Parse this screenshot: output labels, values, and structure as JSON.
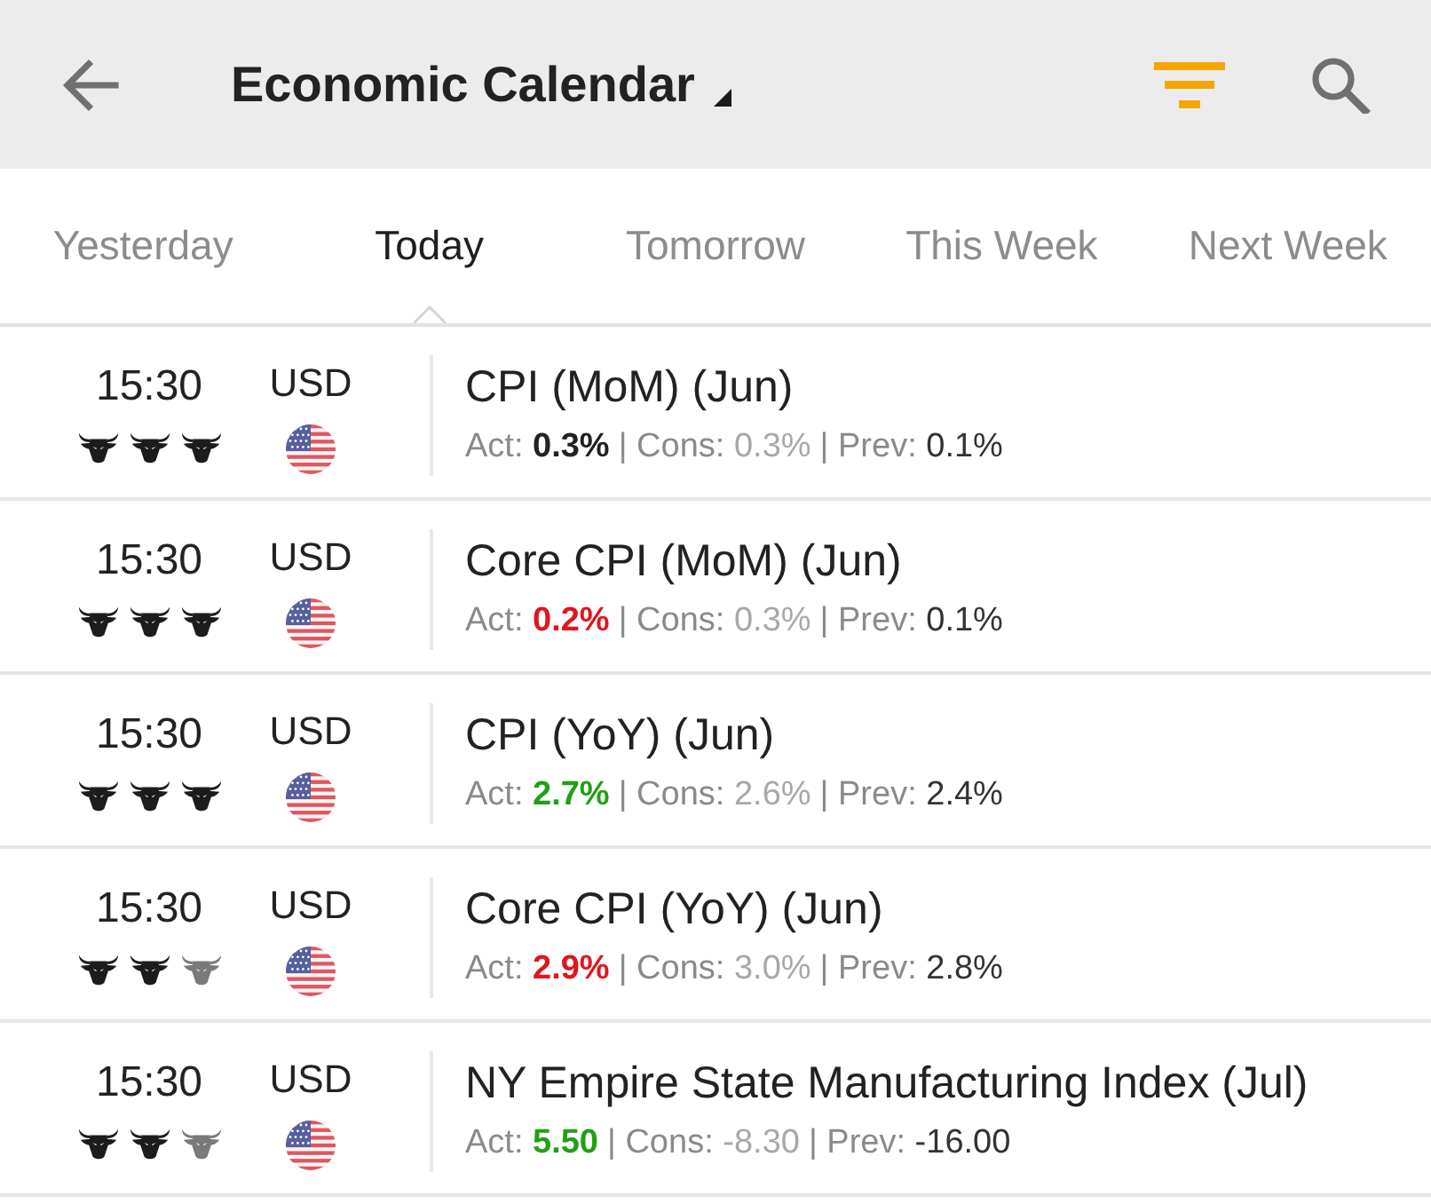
{
  "header": {
    "title": "Economic Calendar"
  },
  "tabs": [
    {
      "label": "Yesterday",
      "selected": false
    },
    {
      "label": "Today",
      "selected": true
    },
    {
      "label": "Tomorrow",
      "selected": false
    },
    {
      "label": "This Week",
      "selected": false
    },
    {
      "label": "Next Week",
      "selected": false
    }
  ],
  "events": [
    {
      "time": "15:30",
      "stars": 3,
      "currency": "USD",
      "name": "CPI (MoM) (Jun)",
      "figures": [
        {
          "kind": "actual",
          "label": "Act:",
          "value": "0.3%",
          "color": "#222222"
        },
        {
          "kind": "consensus",
          "label": "| Cons:",
          "value": "0.3%"
        },
        {
          "kind": "previous",
          "label": "| Prev:",
          "value": "0.1%"
        }
      ]
    },
    {
      "time": "15:30",
      "stars": 3,
      "currency": "USD",
      "name": "Core CPI (MoM) (Jun)",
      "figures": [
        {
          "kind": "actual",
          "label": "Act:",
          "value": "0.2%",
          "color": "#e0161e"
        },
        {
          "kind": "consensus",
          "label": "| Cons:",
          "value": "0.3%"
        },
        {
          "kind": "previous",
          "label": "| Prev:",
          "value": "0.1%"
        }
      ]
    },
    {
      "time": "15:30",
      "stars": 3,
      "currency": "USD",
      "name": "CPI (YoY) (Jun)",
      "figures": [
        {
          "kind": "actual",
          "label": "Act:",
          "value": "2.7%",
          "color": "#22a015"
        },
        {
          "kind": "consensus",
          "label": "| Cons:",
          "value": "2.6%"
        },
        {
          "kind": "previous",
          "label": "| Prev:",
          "value": "2.4%"
        }
      ]
    },
    {
      "time": "15:30",
      "stars": 2,
      "currency": "USD",
      "name": "Core CPI (YoY) (Jun)",
      "figures": [
        {
          "kind": "actual",
          "label": "Act:",
          "value": "2.9%",
          "color": "#e0161e"
        },
        {
          "kind": "consensus",
          "label": "| Cons:",
          "value": "3.0%"
        },
        {
          "kind": "previous",
          "label": "| Prev:",
          "value": "2.8%"
        }
      ]
    },
    {
      "time": "15:30",
      "stars": 2,
      "currency": "USD",
      "name": "NY Empire State Manufacturing Index (Jul)",
      "figures": [
        {
          "kind": "actual",
          "label": "Act:",
          "value": "5.50",
          "color": "#22a015"
        },
        {
          "kind": "consensus",
          "label": "| Cons:",
          "value": "-8.30"
        },
        {
          "kind": "previous",
          "label": "| Prev:",
          "value": "-16.00"
        }
      ]
    }
  ]
}
